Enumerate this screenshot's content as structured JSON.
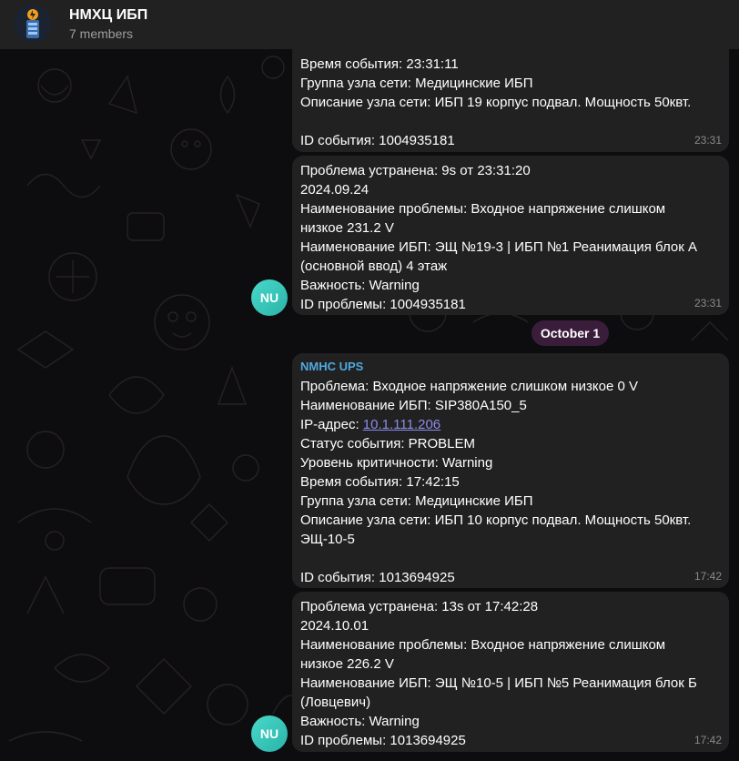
{
  "header": {
    "title": "НМХЦ ИБП",
    "subtitle": "7 members"
  },
  "date_divider": "October 1",
  "avatar_initials": "NU",
  "messages": [
    {
      "lines": [
        "Время события: 23:31:11",
        "Группа узла сети: Медицинские ИБП",
        "Описание узла сети: ИБП 19 корпус подвал. Мощность 50квт.",
        "",
        "ID события: 1004935181"
      ],
      "time": "23:31"
    },
    {
      "lines": [
        "Проблема устранена: 9s от 23:31:20",
        "2024.09.24",
        "Наименование проблемы: Входное напряжение слишком",
        "низкое 231.2 V",
        "Наименование ИБП: ЭЩ №19-3 | ИБП №1 Реанимация блок А",
        "(основной ввод) 4 этаж",
        "Важность: Warning",
        "ID проблемы: 1004935181"
      ],
      "time": "23:31"
    },
    {
      "sender": "NMHC UPS",
      "lines": [
        "Проблема: Входное напряжение слишком низкое 0 V",
        "Наименование ИБП: SIP380A150_5"
      ],
      "ip_label": "IP-адрес: ",
      "ip_link": "10.1.111.206",
      "lines2": [
        "Статус события: PROBLEM",
        "Уровень критичности: Warning",
        "Время события: 17:42:15",
        "Группа узла сети: Медицинские ИБП",
        "Описание узла сети: ИБП 10 корпус подвал. Мощность 50квт.",
        "ЭЩ-10-5",
        "",
        "ID события: 1013694925"
      ],
      "time": "17:42"
    },
    {
      "lines": [
        "Проблема устранена: 13s от 17:42:28",
        "2024.10.01",
        "Наименование проблемы: Входное напряжение слишком",
        "низкое 226.2 V",
        "Наименование ИБП: ЭЩ №10-5 | ИБП №5 Реанимация блок Б",
        "(Ловцевич)",
        "Важность: Warning",
        "ID проблемы: 1013694925"
      ],
      "time": "17:42"
    }
  ]
}
